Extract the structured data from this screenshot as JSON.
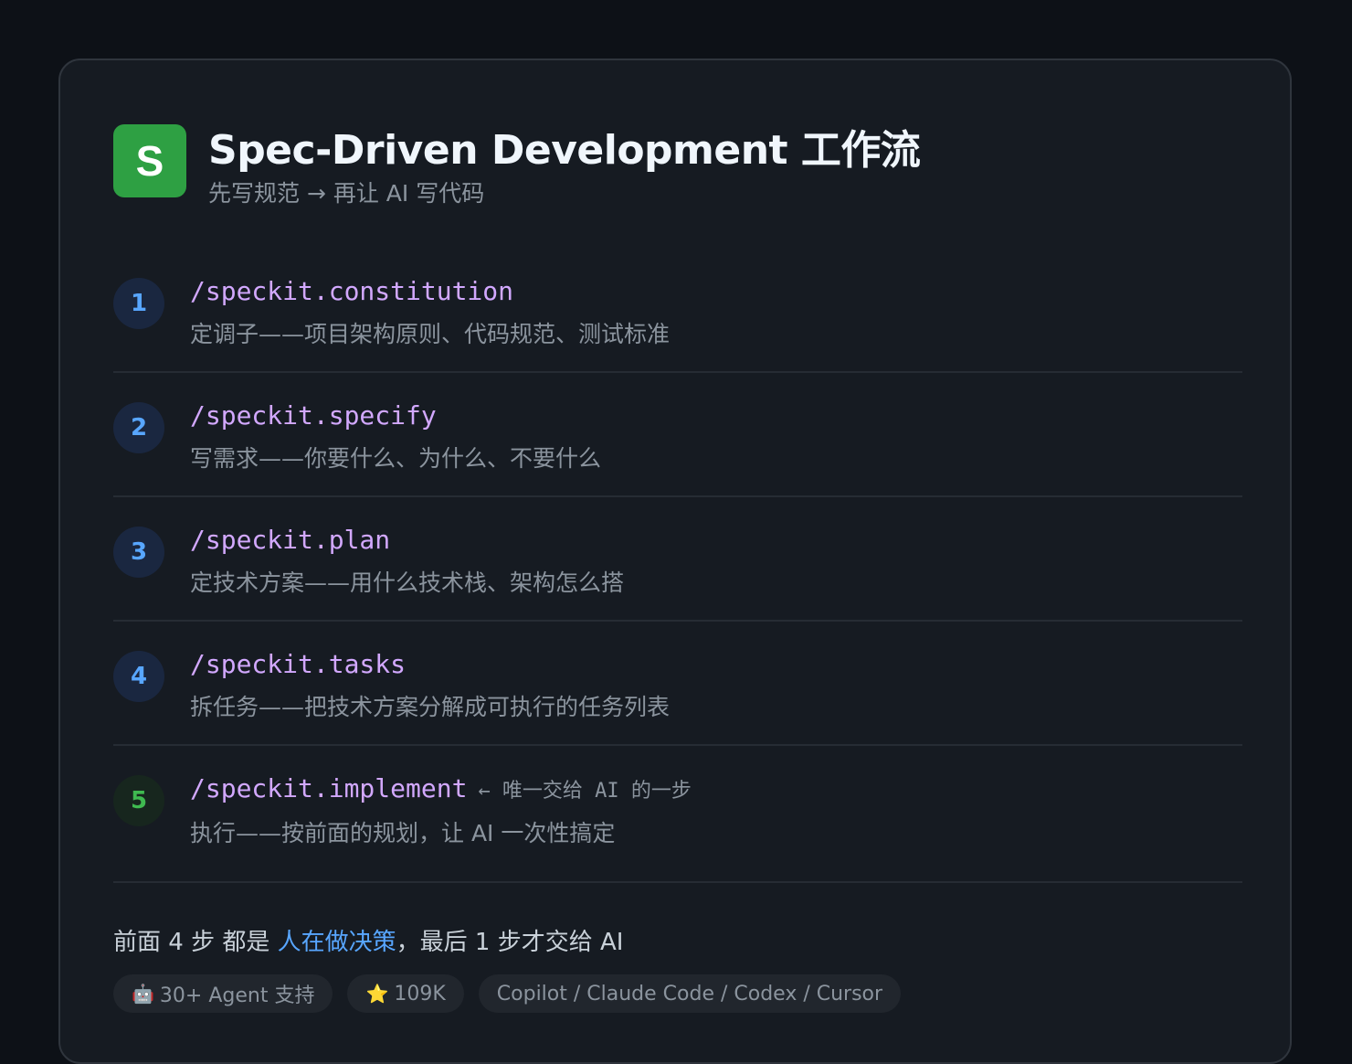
{
  "header": {
    "logo_letter": "S",
    "title": "Spec-Driven Development 工作流",
    "subtitle": "先写规范 → 再让 AI 写代码"
  },
  "steps": [
    {
      "number": "1",
      "command": "/speckit.constitution",
      "description": "定调子——项目架构原则、代码规范、测试标准"
    },
    {
      "number": "2",
      "command": "/speckit.specify",
      "description": "写需求——你要什么、为什么、不要什么"
    },
    {
      "number": "3",
      "command": "/speckit.plan",
      "description": "定技术方案——用什么技术栈、架构怎么搭"
    },
    {
      "number": "4",
      "command": "/speckit.tasks",
      "description": "拆任务——把技术方案分解成可执行的任务列表"
    },
    {
      "number": "5",
      "command": "/speckit.implement",
      "note": "← 唯一交给 AI 的一步",
      "description": "执行——按前面的规划，让 AI 一次性搞定"
    }
  ],
  "footer": {
    "prefix": "前面 4 步 都是 ",
    "highlight": "人在做决策",
    "suffix": "，最后 1 步才交给 AI"
  },
  "badges": {
    "agents": {
      "icon": "robot-icon",
      "glyph": "🤖",
      "label": "30+ Agent 支持"
    },
    "stars": {
      "icon": "star-icon",
      "glyph": "⭐",
      "label": "109K"
    },
    "tools": {
      "label": "Copilot / Claude Code / Codex / Cursor"
    }
  },
  "colors": {
    "background": "#0d1117",
    "card": "#161b22",
    "logo": "#2ea043",
    "command": "#d2a8ff",
    "accent_blue": "#58a6ff",
    "accent_green": "#3fb950"
  }
}
